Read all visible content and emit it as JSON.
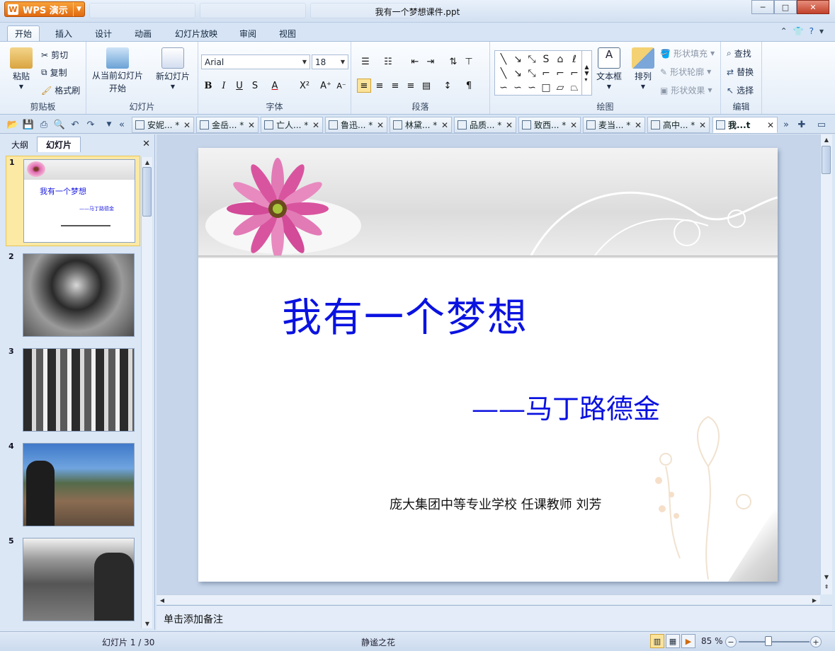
{
  "app": {
    "brand": "WPS 演示",
    "doc_title": "我有一个梦想课件.ppt"
  },
  "window": {
    "minimize": "─",
    "maximize": "□",
    "close": "✕"
  },
  "menu": {
    "tabs": [
      {
        "label": "开始"
      },
      {
        "label": "插入"
      },
      {
        "label": "设计"
      },
      {
        "label": "动画"
      },
      {
        "label": "幻灯片放映"
      },
      {
        "label": "审阅"
      },
      {
        "label": "视图"
      }
    ],
    "active": "开始"
  },
  "ribbon": {
    "clipboard": {
      "paste": "粘贴",
      "cut": "剪切",
      "copy": "复制",
      "format_painter": "格式刷",
      "label": "剪贴板"
    },
    "slides": {
      "from_current_line1": "从当前幻灯片",
      "from_current_line2": "开始",
      "new_slide": "新幻灯片",
      "label": "幻灯片"
    },
    "font": {
      "name": "Arial",
      "size": "18",
      "label": "字体"
    },
    "paragraph": {
      "label": "段落"
    },
    "drawing": {
      "text_box": "文本框",
      "arrange": "排列",
      "shape_fill": "形状填充",
      "shape_outline": "形状轮廓",
      "shape_effect": "形状效果",
      "label": "绘图"
    },
    "editing": {
      "find": "查找",
      "replace": "替换",
      "select": "选择",
      "label": "编辑"
    }
  },
  "doc_tabs": [
    {
      "label": "安妮... *"
    },
    {
      "label": "金岳... *"
    },
    {
      "label": "亡人... *"
    },
    {
      "label": "鲁迅... *"
    },
    {
      "label": "林黛... *"
    },
    {
      "label": "品质... *"
    },
    {
      "label": "致西... *"
    },
    {
      "label": "麦当... *"
    },
    {
      "label": "高中... *"
    },
    {
      "label": "我...t"
    }
  ],
  "left_panel": {
    "tab_outline": "大纲",
    "tab_slides": "幻灯片",
    "close": "✕"
  },
  "thumbnails": [
    {
      "num": "1",
      "title": "我有一个梦想",
      "subtitle": "——马丁路德金"
    },
    {
      "num": "2"
    },
    {
      "num": "3"
    },
    {
      "num": "4"
    },
    {
      "num": "5"
    }
  ],
  "slide": {
    "title": "我有一个梦想",
    "subtitle": "——马丁路德金",
    "footer": "庞大集团中等专业学校 任课教师 刘芳"
  },
  "notes": {
    "placeholder": "单击添加备注"
  },
  "status": {
    "slide_count": "幻灯片 1 / 30",
    "theme": "静谧之花",
    "zoom": "85 %"
  }
}
